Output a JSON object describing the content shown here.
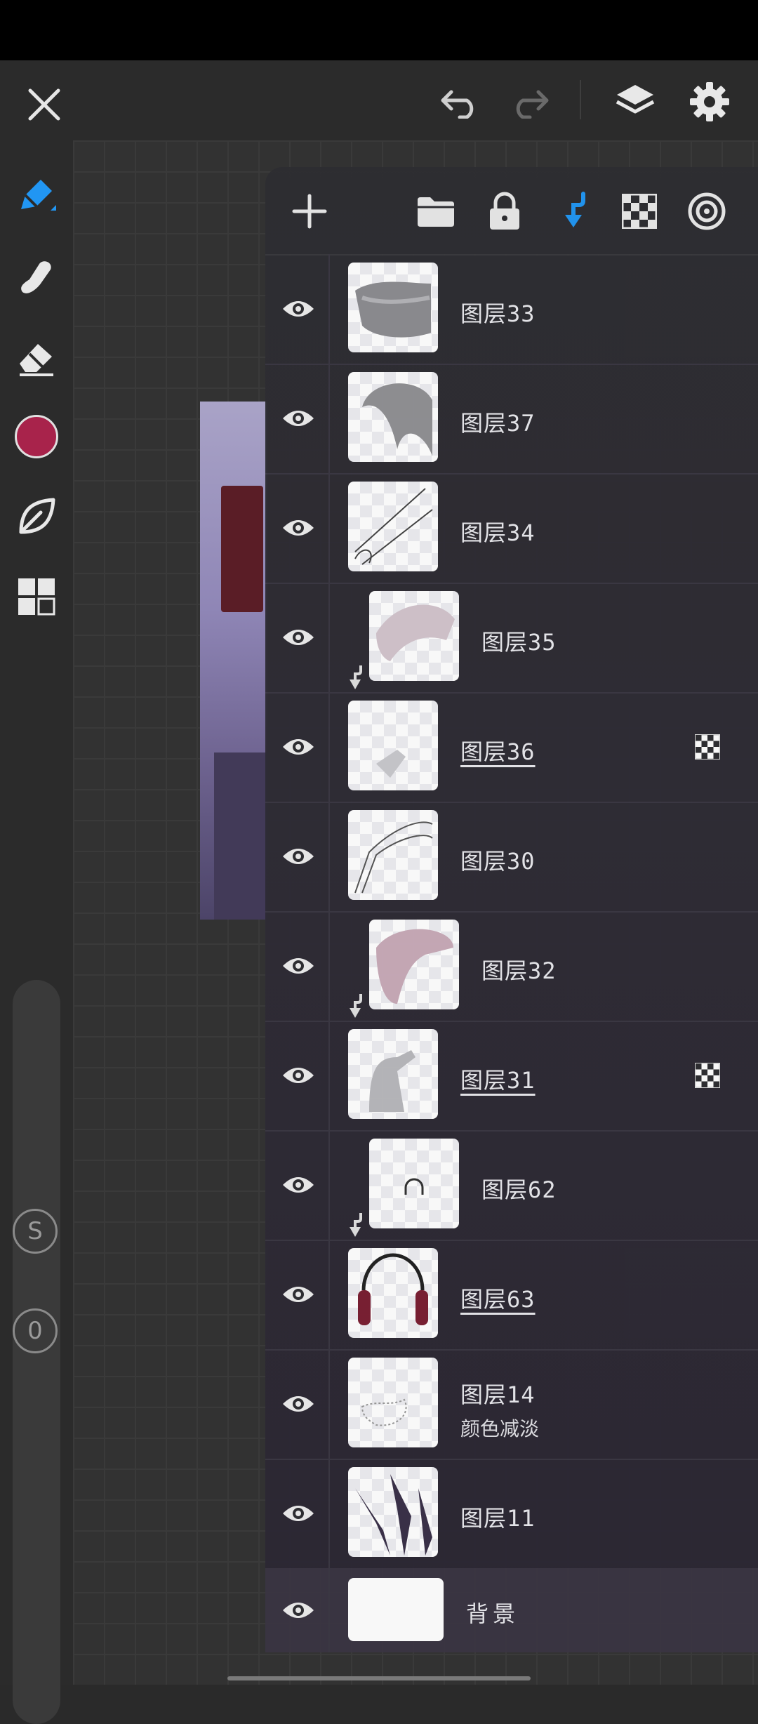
{
  "toolbar": {
    "close": "close-icon",
    "undo": "undo-icon",
    "redo": "redo-icon",
    "layers": "layers-icon",
    "settings": "gear-icon"
  },
  "tools": {
    "brush": "pencil-icon",
    "smudge": "smudge-icon",
    "eraser": "eraser-icon",
    "color": "#a8234b",
    "fill": "leaf-icon",
    "menu": "grid-icon",
    "size_button": "S",
    "opacity_button": "0"
  },
  "layers_panel": {
    "toolbar": [
      "add-icon",
      "folder-icon",
      "lock-icon",
      "clip-down-icon",
      "checker-icon",
      "target-icon"
    ],
    "layers": [
      {
        "name": "图层33",
        "clipped": false,
        "underlined": false,
        "alpha_lock": false
      },
      {
        "name": "图层37",
        "clipped": false,
        "underlined": false,
        "alpha_lock": false
      },
      {
        "name": "图层34",
        "clipped": false,
        "underlined": false,
        "alpha_lock": false
      },
      {
        "name": "图层35",
        "clipped": true,
        "underlined": false,
        "alpha_lock": false
      },
      {
        "name": "图层36",
        "clipped": false,
        "underlined": true,
        "alpha_lock": true
      },
      {
        "name": "图层30",
        "clipped": false,
        "underlined": false,
        "alpha_lock": false
      },
      {
        "name": "图层32",
        "clipped": true,
        "underlined": false,
        "alpha_lock": false
      },
      {
        "name": "图层31",
        "clipped": false,
        "underlined": true,
        "alpha_lock": true
      },
      {
        "name": "图层62",
        "clipped": true,
        "underlined": false,
        "alpha_lock": false
      },
      {
        "name": "图层63",
        "clipped": false,
        "underlined": true,
        "alpha_lock": false
      },
      {
        "name": "图层14",
        "blend": "颜色减淡",
        "clipped": false,
        "underlined": false,
        "alpha_lock": false
      },
      {
        "name": "图层11",
        "clipped": false,
        "underlined": false,
        "alpha_lock": false
      }
    ],
    "background": {
      "name": "背景"
    }
  }
}
